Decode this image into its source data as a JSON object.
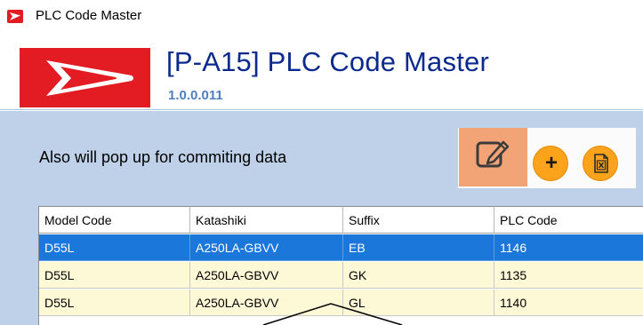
{
  "window": {
    "title": "PLC Code Master",
    "icon": "daihatsu-logo-icon",
    "brand_color": "#e31b23"
  },
  "header": {
    "title": "[P-A15] PLC Code Master",
    "version": "1.0.0.011",
    "logo": "daihatsu-logo"
  },
  "note": "Also will pop up for commiting data",
  "toolbar": {
    "edit_icon": "edit-icon",
    "add_label": "+",
    "excel_icon": "excel-export-icon"
  },
  "grid": {
    "columns": [
      "Model Code",
      "Katashiki",
      "Suffix",
      "PLC Code"
    ],
    "rows": [
      [
        "D55L",
        "A250LA-GBVV",
        "EB",
        "1146"
      ],
      [
        "D55L",
        "A250LA-GBVV",
        "GK",
        "1135"
      ],
      [
        "D55L",
        "A250LA-GBVV",
        "GL",
        "1140"
      ]
    ],
    "selected_row": 0,
    "selection_color": "#1b77d9",
    "row_color": "#fdf8d6"
  }
}
